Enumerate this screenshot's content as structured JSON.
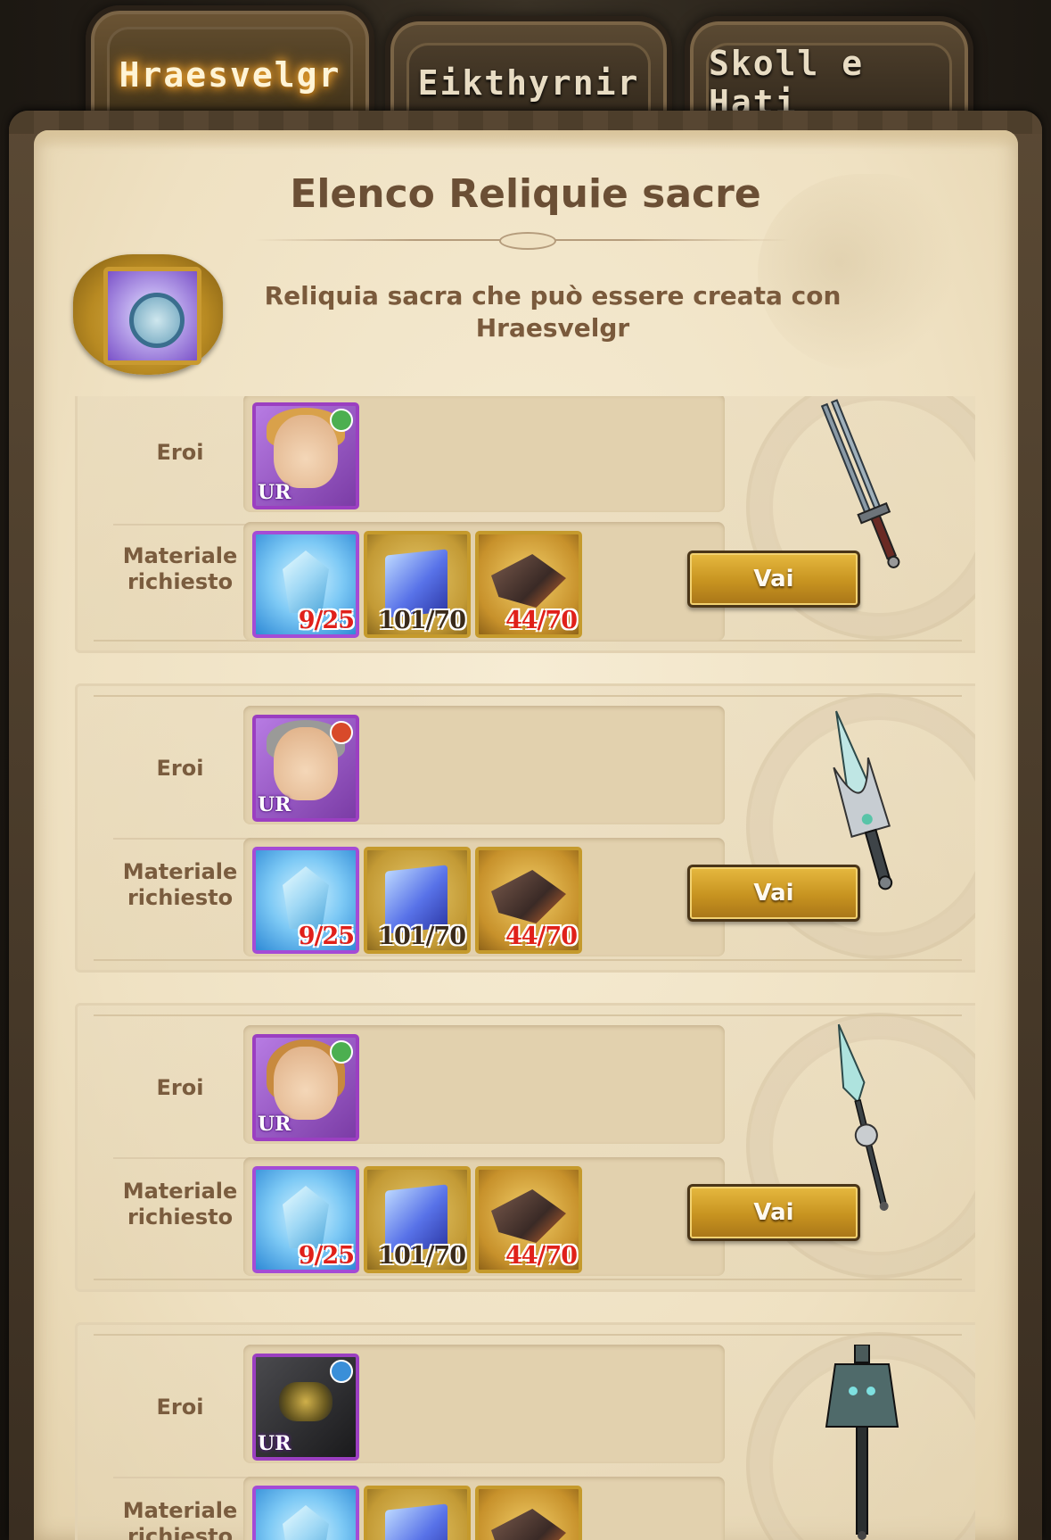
{
  "tabs": [
    {
      "label": "Hraesvelgr",
      "active": true
    },
    {
      "label": "Eikthyrnir",
      "active": false
    },
    {
      "label": "Skoll e Hati",
      "active": false
    }
  ],
  "panel": {
    "title": "Elenco Reliquie sacre",
    "subtitle_line1": "Reliquia sacra che può essere creata con",
    "subtitle_line2": "Hraesvelgr"
  },
  "labels": {
    "heroes": "Eroi",
    "materials_line1": "Materiale",
    "materials_line2": "richiesto"
  },
  "relics": [
    {
      "hero_icon": "blonde-knight-hero-icon",
      "hero_rarity": "UR",
      "element_color": "#4caf50",
      "weapon_icon": "twin-blade-sword-icon",
      "materials": [
        {
          "icon": "crystal-material-icon",
          "qty": "9/25",
          "insufficient": true
        },
        {
          "icon": "cube-material-icon",
          "qty": "101/70",
          "insufficient": false
        },
        {
          "icon": "shard-material-icon",
          "qty": "44/70",
          "insufficient": true
        }
      ],
      "button": "Vai"
    },
    {
      "hero_icon": "old-knight-hero-icon",
      "hero_rarity": "UR",
      "element_color": "#d84a2a",
      "weapon_icon": "short-sword-icon",
      "materials": [
        {
          "icon": "crystal-material-icon",
          "qty": "9/25",
          "insufficient": true
        },
        {
          "icon": "cube-material-icon",
          "qty": "101/70",
          "insufficient": false
        },
        {
          "icon": "shard-material-icon",
          "qty": "44/70",
          "insufficient": true
        }
      ],
      "button": "Vai"
    },
    {
      "hero_icon": "long-hair-hero-icon",
      "hero_rarity": "UR",
      "element_color": "#4caf50",
      "weapon_icon": "spear-icon",
      "materials": [
        {
          "icon": "crystal-material-icon",
          "qty": "9/25",
          "insufficient": true
        },
        {
          "icon": "cube-material-icon",
          "qty": "101/70",
          "insufficient": false
        },
        {
          "icon": "shard-material-icon",
          "qty": "44/70",
          "insufficient": true
        }
      ],
      "button": "Vai"
    },
    {
      "hero_icon": "armored-hero-icon",
      "hero_rarity": "UR",
      "element_color": "#3a8fd8",
      "weapon_icon": "bell-mace-icon",
      "materials": [
        {
          "icon": "crystal-material-icon",
          "qty": "",
          "insufficient": true
        },
        {
          "icon": "cube-material-icon",
          "qty": "",
          "insufficient": false
        },
        {
          "icon": "shard-material-icon",
          "qty": "",
          "insufficient": true
        }
      ],
      "button": ""
    }
  ]
}
